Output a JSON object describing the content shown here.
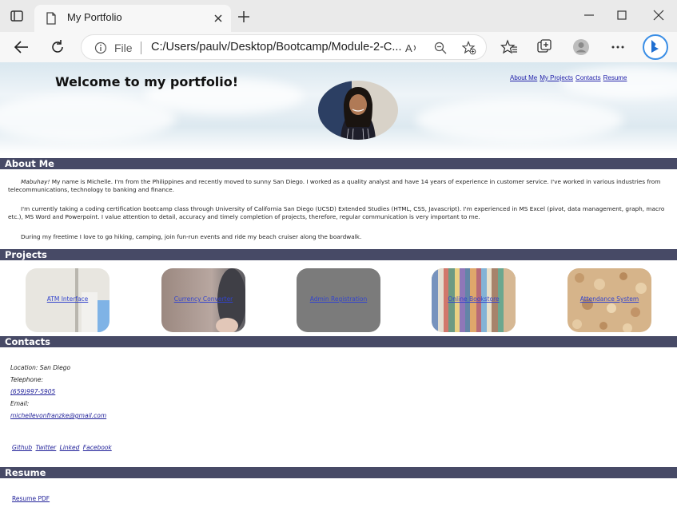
{
  "browser": {
    "tab_title": "My Portfolio",
    "address_prefix": "File",
    "url": "C:/Users/paulv/Desktop/Bootcamp/Module-2-C..."
  },
  "hero": {
    "title": "Welcome to my portfolio!",
    "nav": [
      "About Me",
      "My Projects",
      "Contacts",
      "Resume"
    ]
  },
  "about": {
    "heading": "About Me",
    "greeting": "Mabuhay!",
    "p1_rest": " My name is Michelle. I'm from the Philippines and recently moved to sunny San Diego. I worked as a quality analyst and have 14 years of experience in customer service. I've worked in various industries from telecommunications, technology to banking and finance.",
    "p2": "I'm currently taking a coding certification bootcamp class through University of California San Diego (UCSD) Extended Studies (HTML, CSS, Javascript). I'm experienced in MS Excel (pivot, data management, graph, macro etc.), MS Word and Powerpoint. I value attention to detail, accuracy and timely completion of projects, therefore, regular communication is very important to me.",
    "p3": "During my freetime I love to go hiking, camping, join fun-run events and ride my beach cruiser along the boardwalk."
  },
  "projects": {
    "heading": "Projects",
    "items": [
      "ATM Interface",
      "Currency Converter",
      "Admin Registration",
      "Online Bookstore",
      "Attendance System"
    ]
  },
  "contacts": {
    "heading": "Contacts",
    "location": "Location: San Diego",
    "telephone_label": "Telephone:",
    "phone": "(659)997-5905",
    "email_label": "Email:",
    "email": "michellevonfranzke@gmail.com",
    "social": [
      "Github",
      "Twitter",
      "Linked",
      "Facebook"
    ]
  },
  "resume": {
    "heading": "Resume",
    "link": "Resume PDF"
  },
  "colors": {
    "section_bar": "#474a66",
    "link": "#22229a"
  }
}
